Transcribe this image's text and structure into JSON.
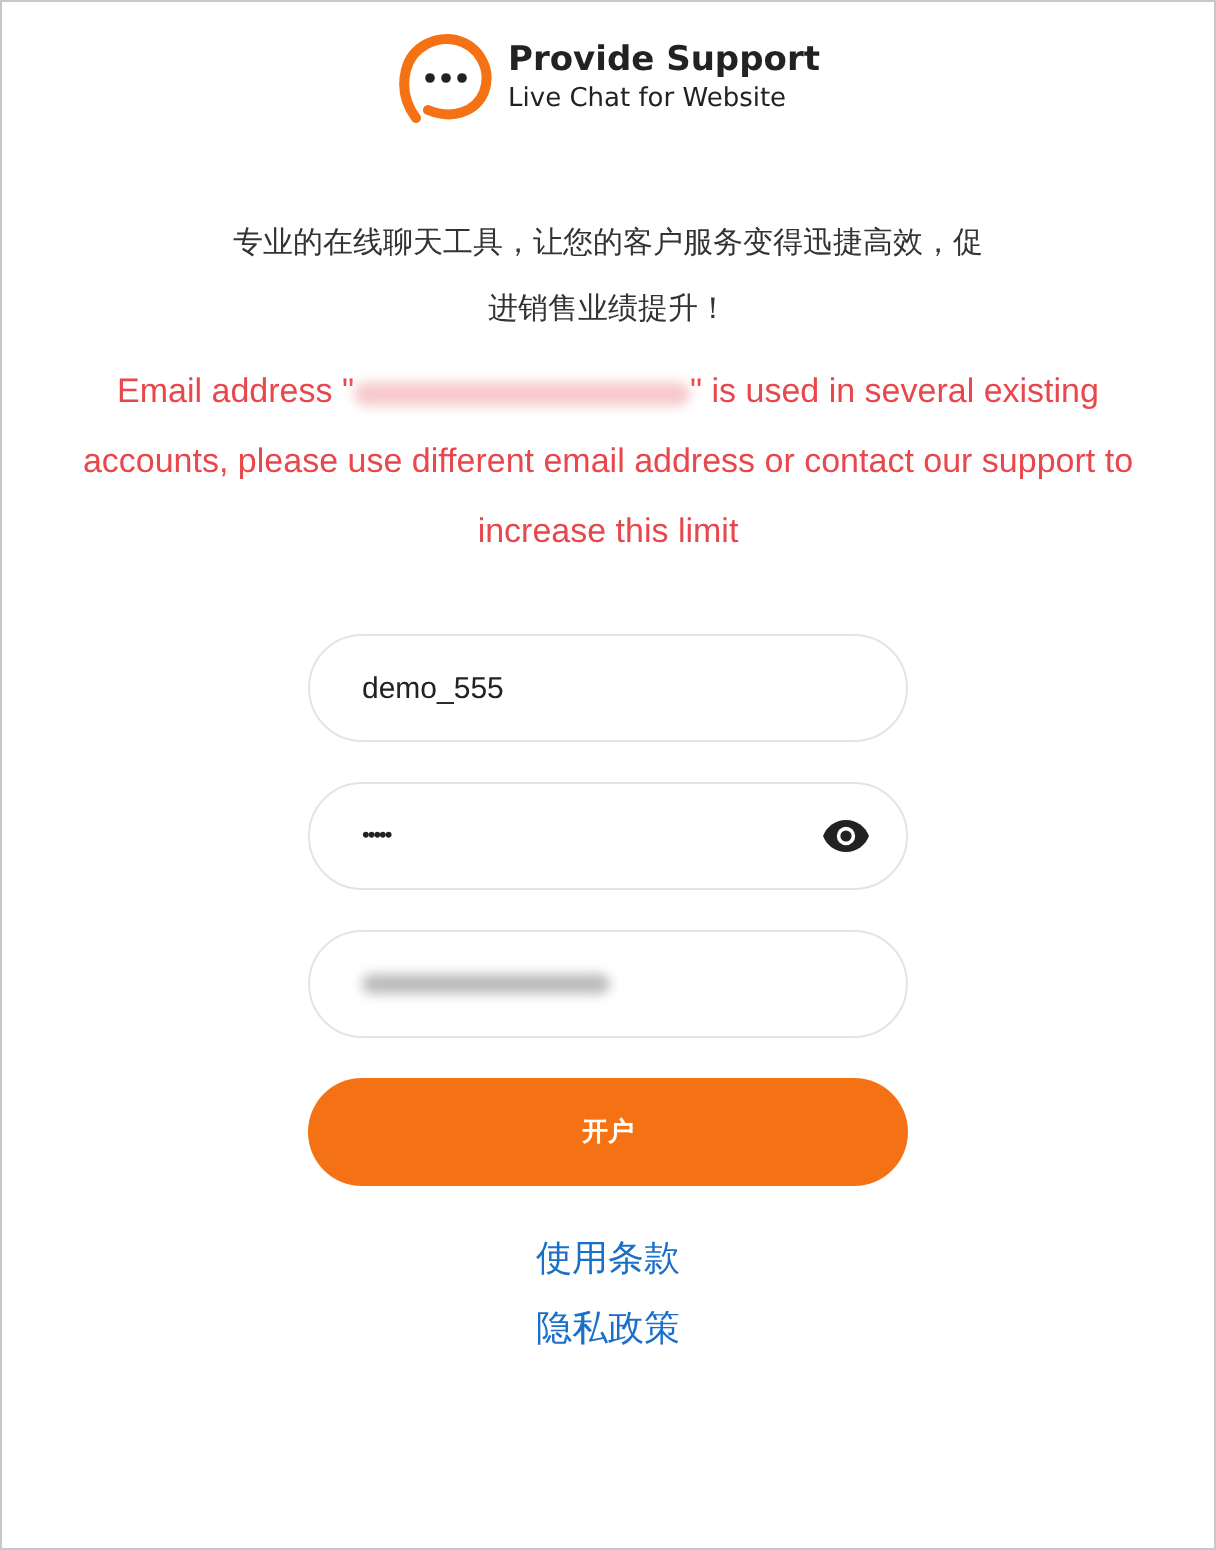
{
  "logo": {
    "name": "Provide Support",
    "tagline": "Live Chat for Website"
  },
  "headline": "专业的在线聊天工具，让您的客户服务变得迅捷高效，促进销售业绩提升！",
  "error": {
    "before": "Email address \"",
    "after": "\" is used in several existing accounts, please use different email address or contact our support to increase this limit"
  },
  "fields": [
    {
      "kind": "text",
      "value": "demo_555"
    },
    {
      "kind": "password",
      "value": "•••••"
    },
    {
      "kind": "redacted"
    }
  ],
  "submit": "开户",
  "links": [
    "使用条款",
    "隐私政策"
  ]
}
